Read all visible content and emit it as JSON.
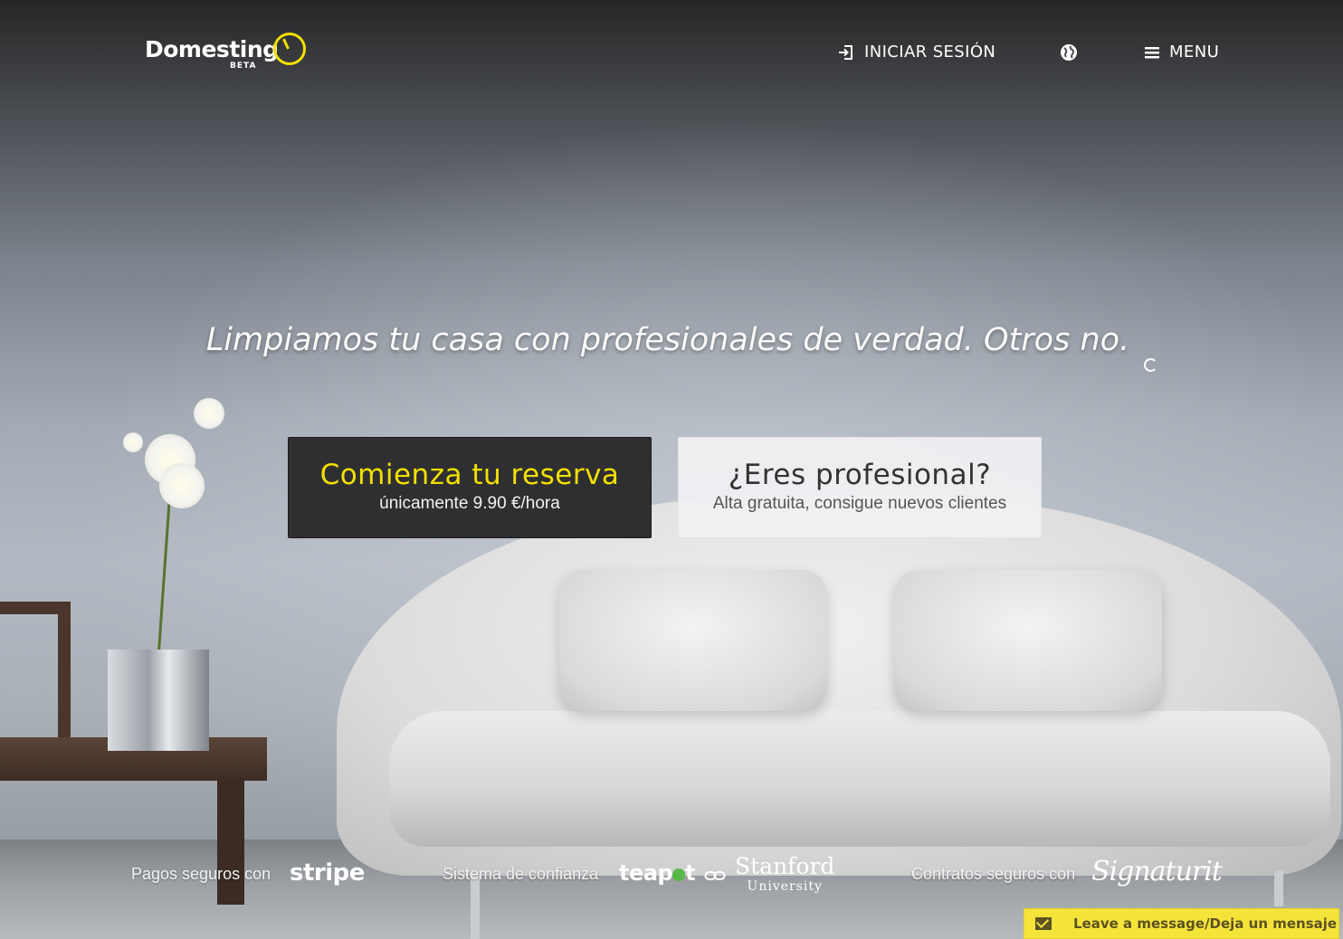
{
  "header": {
    "logo_text": "Domesting",
    "logo_badge": "BETA",
    "login_label": "INICIAR SESIÓN",
    "menu_label": "MENU"
  },
  "hero": {
    "headline": "Limpiamos tu casa con profesionales de verdad. Otros no.",
    "cta_book": {
      "title": "Comienza tu reserva",
      "subtitle": "únicamente 9.90 €/hora"
    },
    "cta_pro": {
      "title": "¿Eres profesional?",
      "subtitle": "Alta gratuita, consigue nuevos clientes"
    }
  },
  "partners": {
    "payments_label": "Pagos seguros con",
    "payments_brand": "stripe",
    "trust_label": "Sistema de confianza",
    "trust_brand_a": "teap",
    "trust_brand_b": "t",
    "trust_brand_c_line1": "Stanford",
    "trust_brand_c_line2": "University",
    "contracts_label": "Contratos seguros con",
    "contracts_brand": "Signaturit"
  },
  "chat": {
    "label": "Leave a message/Deja un mensaje"
  },
  "colors": {
    "accent_yellow": "#f1e000",
    "cta_dark": "#2f2f31",
    "chat_bg": "#f4e43a"
  },
  "icons": {
    "login": "sign-in-icon",
    "language": "globe-icon",
    "menu": "hamburger-icon",
    "chat": "envelope-icon"
  }
}
